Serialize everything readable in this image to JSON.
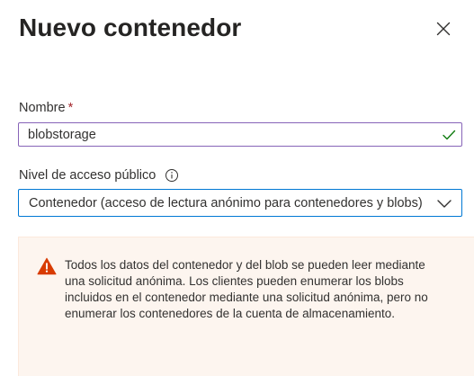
{
  "panel": {
    "title": "Nuevo contenedor",
    "close_icon": "close-icon"
  },
  "name_field": {
    "label": "Nombre",
    "required_marker": "*",
    "value": "blobstorage",
    "valid_icon": "checkmark-icon"
  },
  "access_field": {
    "label": "Nivel de acceso público",
    "info_icon": "info-icon",
    "selected_value": "Contenedor (acceso de lectura anónimo para contenedores y blobs)",
    "chevron_icon": "chevron-down-icon"
  },
  "warning": {
    "icon": "warning-icon",
    "message": "Todos los datos del contenedor y del blob se pueden leer mediante una solicitud anónima. Los clientes pueden enumerar los blobs incluidos en el contenedor mediante una solicitud anónima, pero no enumerar los contenedores de la cuenta de almacenamiento."
  },
  "colors": {
    "input_border": "#8764b8",
    "select_border": "#0078d4",
    "required": "#a4262c",
    "success": "#107c10",
    "warning_icon": "#d83b01",
    "warning_bg": "#fdf5ef"
  }
}
